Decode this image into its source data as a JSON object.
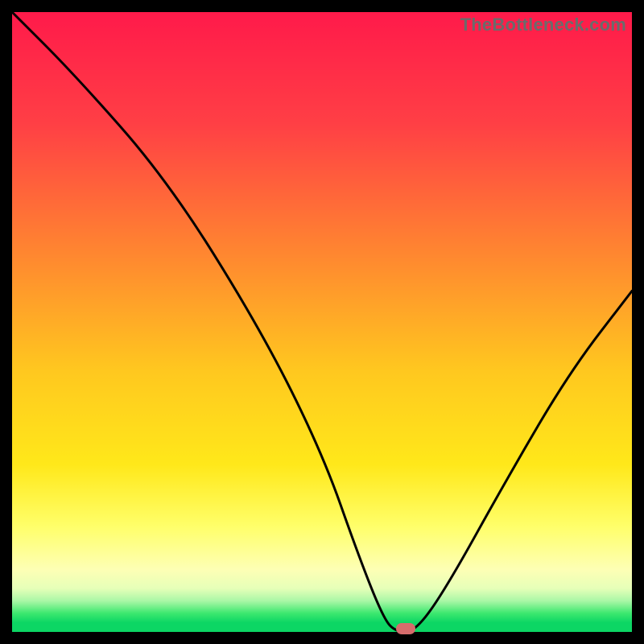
{
  "watermark": "TheBottleneck.com",
  "chart_data": {
    "type": "line",
    "title": "",
    "xlabel": "",
    "ylabel": "",
    "ylim": [
      0,
      100
    ],
    "x": [
      0,
      10,
      25,
      40,
      50,
      56,
      60,
      62,
      65,
      70,
      80,
      90,
      100
    ],
    "values": [
      100,
      90,
      73,
      49,
      29,
      12,
      2,
      0,
      0,
      7,
      25,
      42,
      55
    ],
    "notch": {
      "x": 63.5,
      "y": 0
    },
    "background_gradient_stops": [
      {
        "pct": 0,
        "color": "#ff1a4a"
      },
      {
        "pct": 18,
        "color": "#ff3f45"
      },
      {
        "pct": 40,
        "color": "#ff8a2f"
      },
      {
        "pct": 58,
        "color": "#ffc81f"
      },
      {
        "pct": 73,
        "color": "#ffe81a"
      },
      {
        "pct": 83,
        "color": "#ffff6a"
      },
      {
        "pct": 90,
        "color": "#fdffb5"
      },
      {
        "pct": 93,
        "color": "#e6ffb8"
      },
      {
        "pct": 95,
        "color": "#a9f7a6"
      },
      {
        "pct": 97,
        "color": "#3ce86f"
      },
      {
        "pct": 100,
        "color": "#0cd664"
      }
    ]
  }
}
